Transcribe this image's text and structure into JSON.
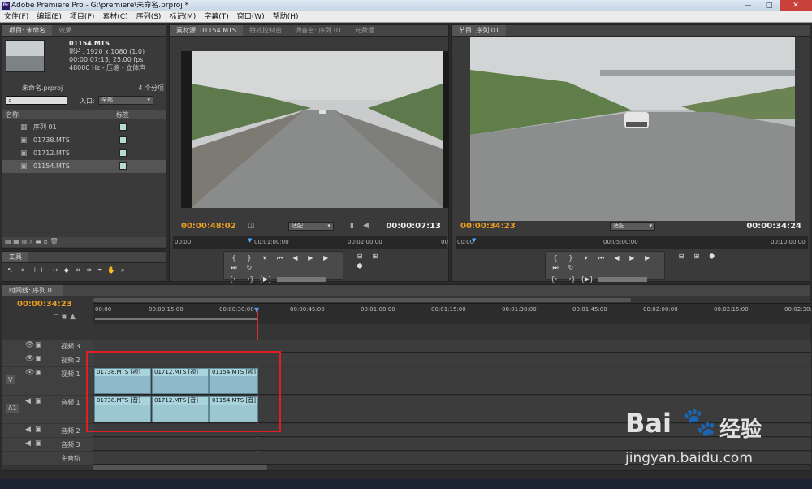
{
  "window": {
    "title": "Adobe Premiere Pro - G:\\premiere\\未命名.prproj *",
    "app_logo": "Pr"
  },
  "menu": [
    "文件(F)",
    "编辑(E)",
    "项目(P)",
    "素材(C)",
    "序列(S)",
    "标记(M)",
    "字幕(T)",
    "窗口(W)",
    "帮助(H)"
  ],
  "project": {
    "tabs": [
      "项目: 未命名",
      "效果"
    ],
    "clip_name": "01154.MTS",
    "info1": "影片, 1920 x 1080 (1.0)",
    "info2": "00:00:07:13, 25.00 fps",
    "info3": "48000 Hz - 压缩 - 立体声",
    "project_file": "未命名.prproj",
    "item_count": "4 个分项",
    "inpoint_label": "入口:",
    "inpoint_value": "全部",
    "col_name": "名称",
    "col_label": "标签",
    "items": [
      {
        "name": "序列 01",
        "color": "#b9dcd2"
      },
      {
        "name": "01738.MTS",
        "color": "#b9dcd2"
      },
      {
        "name": "01712.MTS",
        "color": "#b9dcd2"
      },
      {
        "name": "01154.MTS",
        "color": "#b9dcd2"
      }
    ]
  },
  "source": {
    "tabs": [
      "素材源: 01154.MTS",
      "特效控制台",
      "调音台: 序列 01",
      "元数据"
    ],
    "timecode": "00:00:48:02",
    "fit": "适配",
    "duration": "00:00:07:13",
    "ruler": [
      "00:00",
      "00:01:00:00",
      "00:02:00:00",
      "00"
    ]
  },
  "program": {
    "tabs": [
      "节目: 序列 01"
    ],
    "timecode": "00:00:34:23",
    "fit": "适配",
    "duration": "00:00:34:24",
    "ruler": [
      "00:00",
      "00:05:00:00",
      "00:10:00:00"
    ]
  },
  "tools": {
    "title": "工具"
  },
  "timeline": {
    "tab": "时间线: 序列 01",
    "timecode": "00:00:34:23",
    "ruler": [
      "00:00",
      "00:00:15:00",
      "00:00:30:00",
      "00:00:45:00",
      "00:01:00:00",
      "00:01:15:00",
      "00:01:30:00",
      "00:01:45:00",
      "00:02:00:00",
      "00:02:15:00",
      "00:02:30:00"
    ],
    "tracks": {
      "v3": "视频 3",
      "v2": "视频 2",
      "v1": "视频 1",
      "a1": "音频 1",
      "a2": "音频 2",
      "a3": "音频 3",
      "master": "主音轨",
      "v_target": "V",
      "a_target": "A1"
    },
    "video_clips": [
      "01738.MTS [视]",
      "01712.MTS [视]",
      "01154.MTS [视]"
    ],
    "audio_clips": [
      "01738.MTS [音]",
      "01712.MTS [音]",
      "01154.MTS [音]"
    ]
  },
  "watermark": {
    "brand": "Bai",
    "brand2": "经验",
    "url": "jingyan.baidu.com"
  },
  "colors": {
    "timecode": "#f0a020",
    "highlight": "#e02020",
    "clip": "#8fb8c8"
  }
}
